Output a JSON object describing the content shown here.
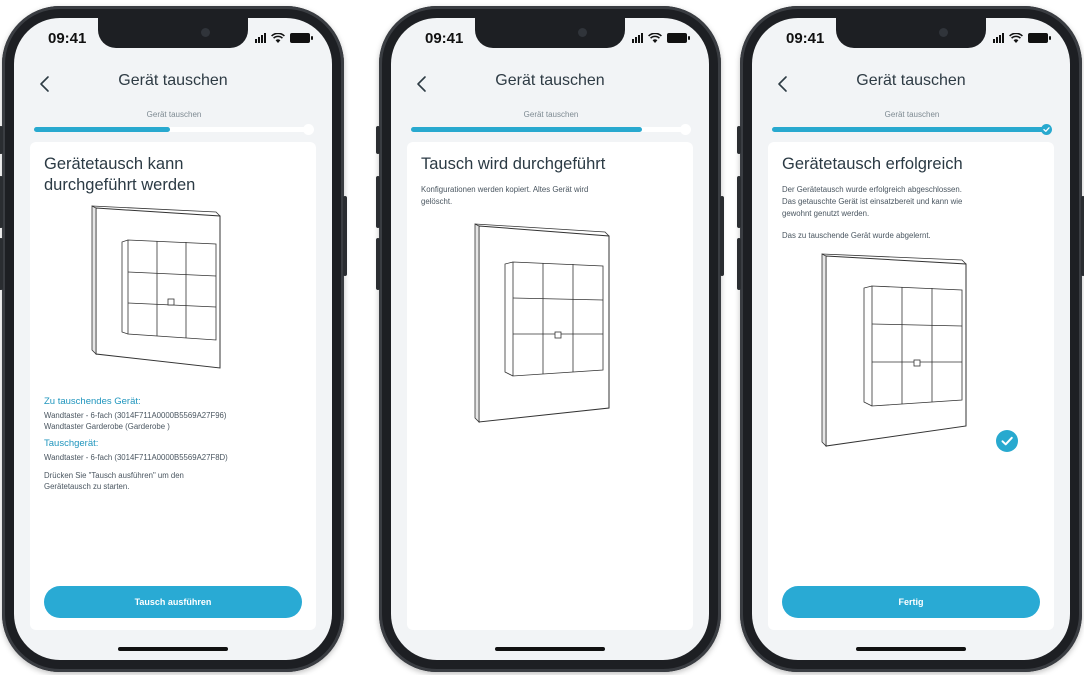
{
  "status_time": "09:41",
  "nav_title": "Gerät tauschen",
  "progress_label": "Gerät tauschen",
  "colors": {
    "accent": "#28a9cf",
    "accent_dark": "#1f95bd",
    "screen_bg": "#f2f4f6"
  },
  "screens": [
    {
      "progress_percent": 50,
      "progress_complete": false,
      "title": "Gerätetausch kann durchgeführt werden",
      "old_device_heading": "Zu tauschendes Gerät:",
      "old_device_line1": "Wandtaster - 6-fach (3014F711A0000B5569A27F96)",
      "old_device_line2": "Wandtaster Garderobe (Garderobe )",
      "new_device_heading": "Tauschgerät:",
      "new_device_line1": "Wandtaster - 6-fach (3014F711A0000B5569A27F8D)",
      "hint_line1": "Drücken Sie \"Tausch ausführen\" um den",
      "hint_line2": "Gerätetausch zu starten.",
      "button_label": "Tausch ausführen"
    },
    {
      "progress_percent": 85,
      "progress_complete": false,
      "title": "Tausch wird durchgeführt",
      "text_line1": "Konfigurationen werden kopiert. Altes Gerät wird",
      "text_line2": "gelöscht."
    },
    {
      "progress_percent": 100,
      "progress_complete": true,
      "title": "Gerätetausch erfolgreich",
      "text_line1": "Der Gerätetausch wurde erfolgreich abgeschlossen.",
      "text_line2": "Das getauschte Gerät ist einsatzbereit und kann wie",
      "text_line3": "gewohnt genutzt werden.",
      "text_line4": "Das zu tauschende Gerät wurde abgelernt.",
      "button_label": "Fertig"
    }
  ],
  "icons": [
    "back-chevron-icon",
    "signal-icon",
    "wifi-icon",
    "battery-icon",
    "checkmark-icon",
    "wall-switch-illustration"
  ]
}
